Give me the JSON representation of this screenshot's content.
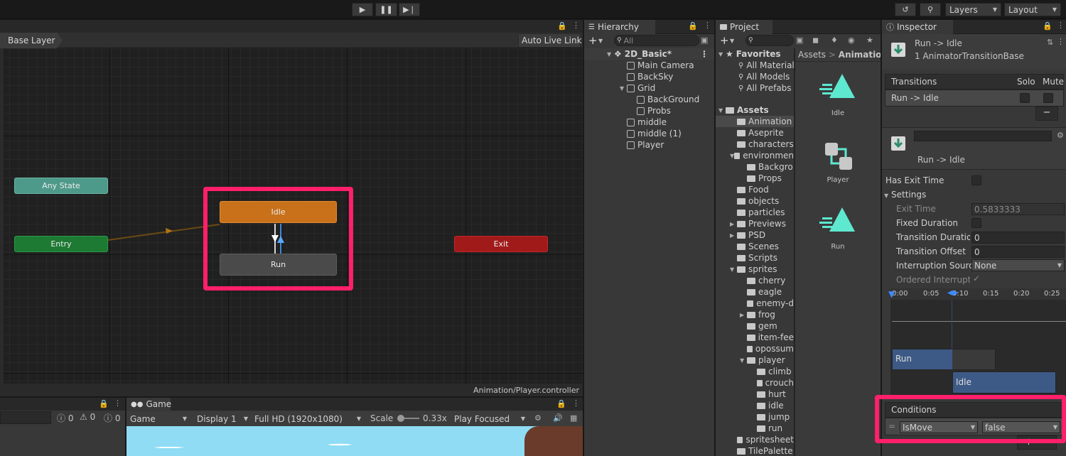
{
  "toolbar": {
    "layers": "Layers",
    "layout": "Layout"
  },
  "animator": {
    "breadcrumb": "Base Layer",
    "live_link": "Auto Live Link",
    "footer_path": "Animation/Player.controller",
    "nodes": {
      "any_state": "Any State",
      "entry": "Entry",
      "idle": "Idle",
      "run": "Run",
      "exit": "Exit"
    }
  },
  "hierarchy": {
    "tab": "Hierarchy",
    "search_placeholder": "All",
    "scene": "2D_Basic*",
    "items": [
      "Main Camera",
      "BackSky",
      "Grid",
      "BackGround",
      "Probs",
      "middle",
      "middle (1)",
      "Player"
    ]
  },
  "project": {
    "tab": "Project",
    "favorites_label": "Favorites",
    "favorites": [
      "All Material",
      "All Models",
      "All Prefabs"
    ],
    "assets_label": "Assets",
    "folders": [
      "Animation",
      "Aseprite",
      "characters",
      "environmen",
      "Backgro",
      "Props",
      "Food",
      "objects",
      "particles",
      "Previews",
      "PSD",
      "Scenes",
      "Scripts",
      "sprites",
      "cherry",
      "eagle",
      "enemy-d",
      "frog",
      "gem",
      "item-fee",
      "opossum",
      "player",
      "climb",
      "crouch",
      "hurt",
      "idle",
      "jump",
      "run",
      "spritesheet",
      "TilePalette"
    ],
    "breadcrumb": [
      "Assets",
      "Animation"
    ],
    "assets": [
      "Idle",
      "Player",
      "Run"
    ]
  },
  "inspector": {
    "tab": "Inspector",
    "title": "Run -> Idle",
    "subtitle": "1 AnimatorTransitionBase",
    "transitions_label": "Transitions",
    "solo_label": "Solo",
    "mute_label": "Mute",
    "transition_row": "Run -> Idle",
    "transition_name": "Run -> Idle",
    "has_exit_time": "Has Exit Time",
    "settings": "Settings",
    "exit_time": "Exit Time",
    "exit_time_value": "0.5833333",
    "fixed_duration": "Fixed Duration",
    "transition_duration": "Transition Duratio",
    "transition_duration_value": "0",
    "transition_offset": "Transition Offset",
    "transition_offset_value": "0",
    "interruption_source": "Interruption Source",
    "interruption_source_value": "None",
    "ordered_interruption": "Ordered Interruptio",
    "timeline_ticks": [
      "0:00",
      "0:05",
      "0:10",
      "0:15",
      "0:20",
      "0:25"
    ],
    "timeline_run": "Run",
    "timeline_idle": "Idle",
    "conditions_label": "Conditions",
    "condition_param": "IsMove",
    "condition_value": "false"
  },
  "console": {
    "err_count": "0",
    "warn_count": "0",
    "info_count": "0"
  },
  "game": {
    "tab": "Game",
    "mode": "Game",
    "display": "Display 1",
    "resolution": "Full HD (1920x1080)",
    "scale_label": "Scale",
    "scale_value": "0.33x",
    "play_focused": "Play Focused"
  },
  "colors": {
    "highlight": "#ff1f6a",
    "idle": "#c8711a",
    "entry": "#1d7a32",
    "exit": "#a11a1a",
    "any_state": "#4e9a8a"
  }
}
